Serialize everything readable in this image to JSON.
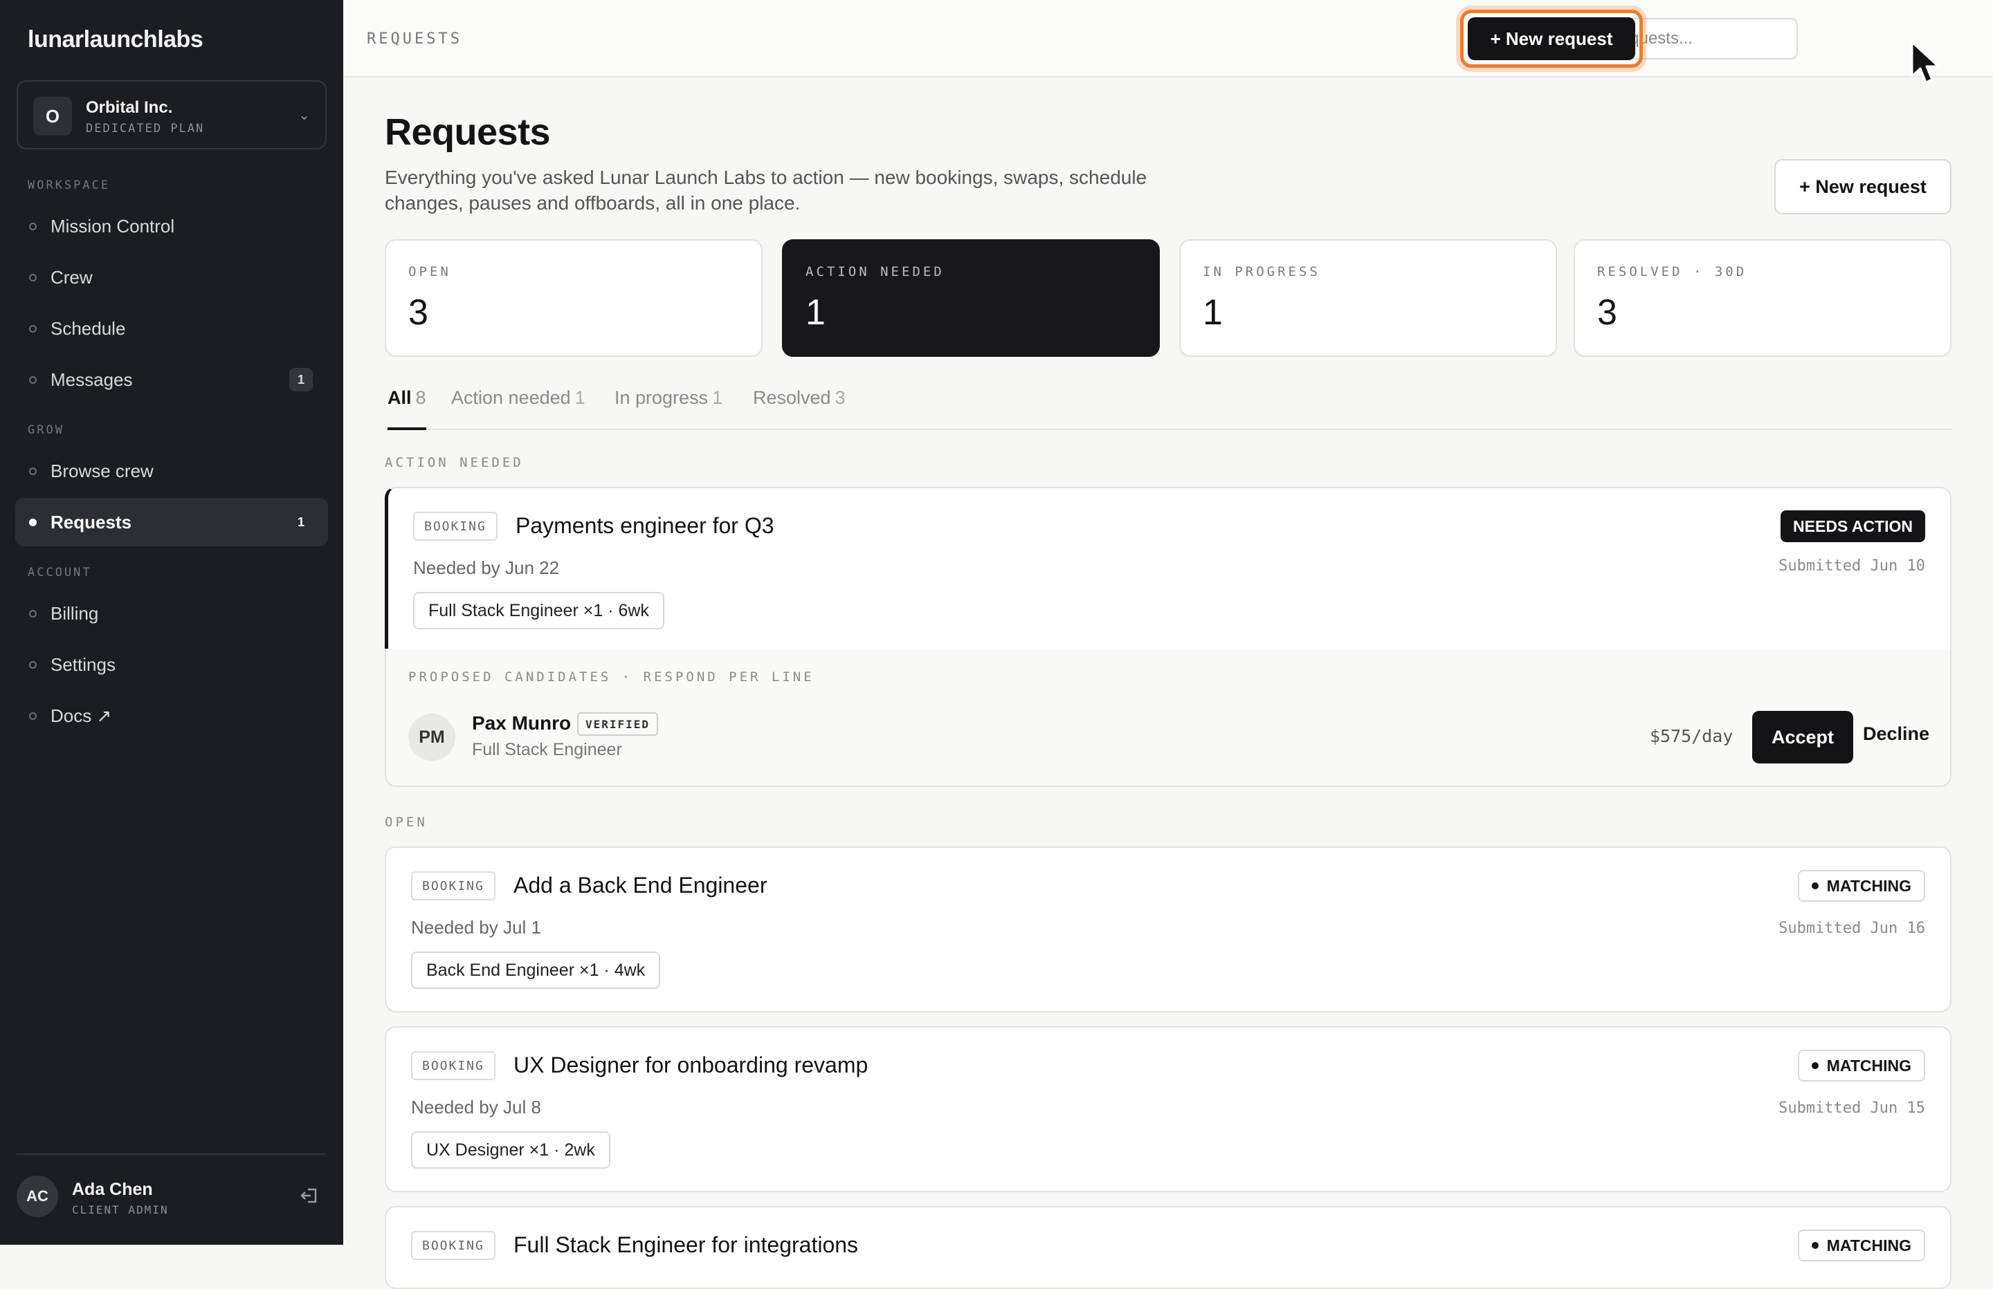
{
  "brand": "lunarlaunchlabs",
  "org": {
    "initial": "O",
    "name": "Orbital Inc.",
    "plan": "DEDICATED PLAN"
  },
  "nav": {
    "workspace_label": "WORKSPACE",
    "grow_label": "GROW",
    "account_label": "ACCOUNT",
    "items": [
      {
        "label": "Mission Control"
      },
      {
        "label": "Crew"
      },
      {
        "label": "Schedule"
      },
      {
        "label": "Messages",
        "badge": "1"
      },
      {
        "label": "Browse crew"
      },
      {
        "label": "Requests",
        "badge": "1",
        "active": true
      },
      {
        "label": "Billing"
      },
      {
        "label": "Settings"
      },
      {
        "label": "Docs ↗"
      }
    ]
  },
  "user": {
    "initials": "AC",
    "name": "Ada Chen",
    "role": "CLIENT ADMIN"
  },
  "topbar": {
    "breadcrumb": "REQUESTS",
    "search_placeholder": "Search requests...",
    "new_request": "+ New request"
  },
  "page": {
    "title": "Requests",
    "description": "Everything you've asked Lunar Launch Labs to action — new bookings, swaps, schedule changes, pauses and offboards, all in one place.",
    "new_request": "+ New request"
  },
  "stats": [
    {
      "label": "OPEN",
      "value": "3"
    },
    {
      "label": "ACTION NEEDED",
      "value": "1"
    },
    {
      "label": "IN PROGRESS",
      "value": "1"
    },
    {
      "label": "RESOLVED · 30D",
      "value": "3"
    }
  ],
  "tabs": [
    {
      "label": "All",
      "count": "8"
    },
    {
      "label": "Action needed",
      "count": "1"
    },
    {
      "label": "In progress",
      "count": "1"
    },
    {
      "label": "Resolved",
      "count": "3"
    }
  ],
  "groups": {
    "action_needed": "ACTION NEEDED",
    "open": "OPEN"
  },
  "requests": [
    {
      "type": "BOOKING",
      "title": "Payments engineer for Q3",
      "needed": "Needed by Jun 22",
      "chip": "Full Stack Engineer ×1 · 6wk",
      "status": "NEEDS ACTION",
      "submitted": "Submitted Jun 10"
    },
    {
      "type": "BOOKING",
      "title": "Add a Back End Engineer",
      "needed": "Needed by Jul 1",
      "chip": "Back End Engineer ×1 · 4wk",
      "status": "MATCHING",
      "submitted": "Submitted Jun 16"
    },
    {
      "type": "BOOKING",
      "title": "UX Designer for onboarding revamp",
      "needed": "Needed by Jul 8",
      "chip": "UX Designer ×1 · 2wk",
      "status": "MATCHING",
      "submitted": "Submitted Jun 15"
    },
    {
      "type": "BOOKING",
      "title": "Full Stack Engineer for integrations",
      "status": "MATCHING"
    }
  ],
  "candidates": {
    "label": "PROPOSED CANDIDATES · RESPOND PER LINE",
    "items": [
      {
        "initials": "PM",
        "name": "Pax Munro",
        "badge": "VERIFIED",
        "role": "Full Stack Engineer",
        "rate": "$575/day",
        "accept": "Accept",
        "decline": "Decline"
      }
    ]
  },
  "colors": {
    "sidebar_bg": "#1c1d20",
    "highlight": "#f07b2d",
    "dark_button": "#141416"
  }
}
